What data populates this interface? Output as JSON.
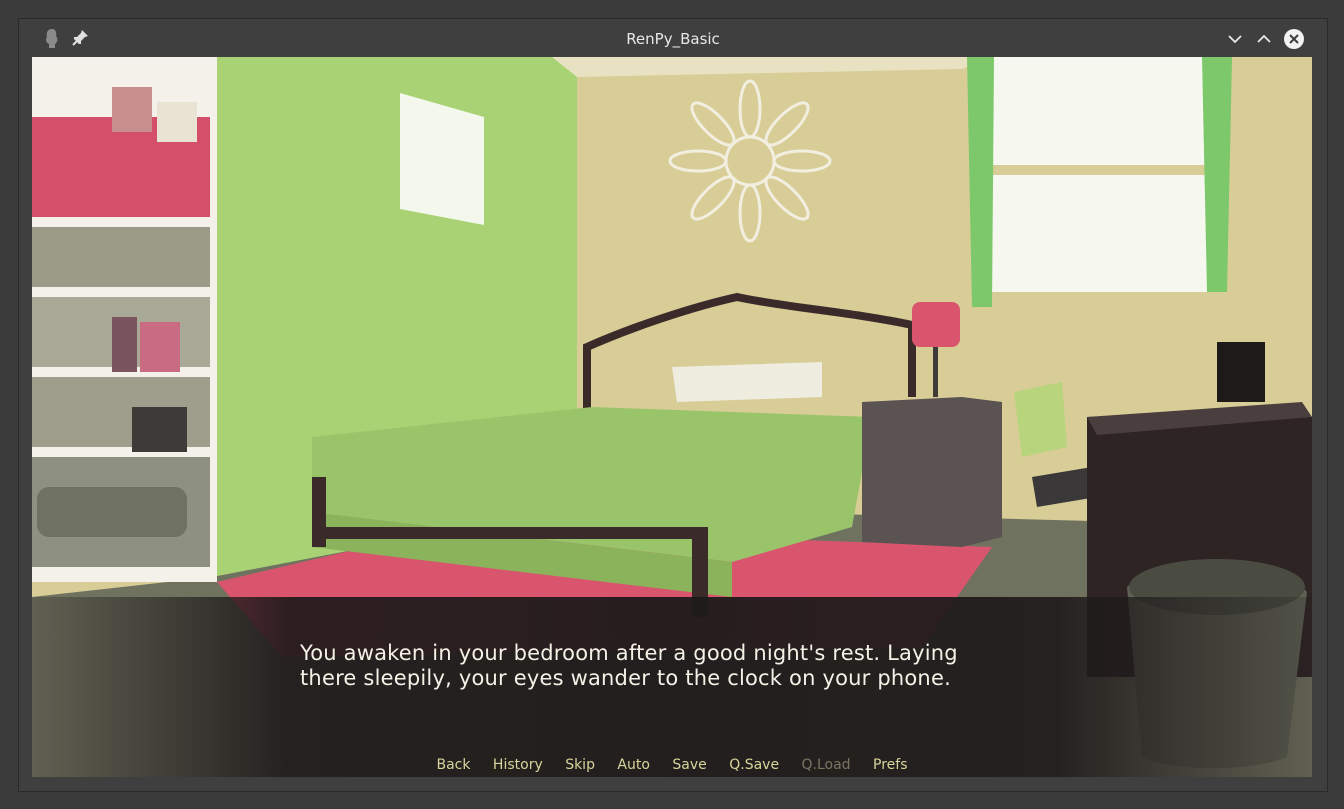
{
  "window": {
    "title": "RenPy_Basic"
  },
  "dialogue": {
    "line1": "You awaken in your bedroom after a good night's rest. Laying",
    "line2": "there sleepily, your eyes wander to the clock on your phone."
  },
  "quick_menu": [
    {
      "label": "Back",
      "enabled": true
    },
    {
      "label": "History",
      "enabled": true
    },
    {
      "label": "Skip",
      "enabled": true
    },
    {
      "label": "Auto",
      "enabled": true
    },
    {
      "label": "Save",
      "enabled": true
    },
    {
      "label": "Q.Save",
      "enabled": true
    },
    {
      "label": "Q.Load",
      "enabled": false
    },
    {
      "label": "Prefs",
      "enabled": true
    }
  ],
  "colors": {
    "quick_menu_text": "#d9d49b",
    "quick_menu_disabled": "#7a7660",
    "dialogue_text": "#f4f1e6"
  },
  "icons": [
    "app-icon",
    "pin-icon",
    "minimize-icon",
    "maximize-icon",
    "close-icon"
  ]
}
